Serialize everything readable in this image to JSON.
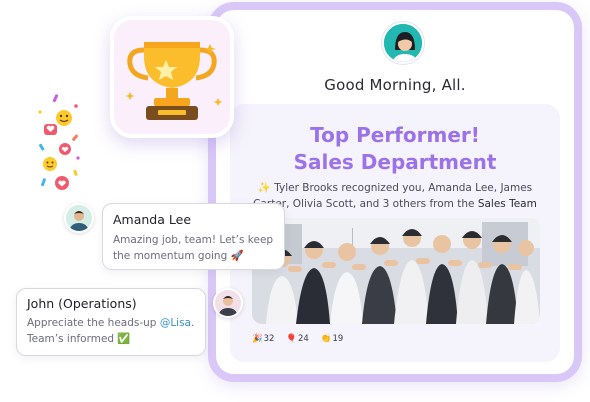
{
  "card": {
    "greeting": "Good Morning, All.",
    "title_line1": "Top Performer!",
    "title_line2": "Sales Department",
    "recognition_prefix": "✨ Tyler Brooks recognized you, Amanda Lee, James Carter, Olivia Scott, and 3 others from the ",
    "recognition_team": "Sales Team",
    "reactions": [
      {
        "emoji": "🎉",
        "count": "32"
      },
      {
        "emoji": "🎈",
        "count": "24"
      },
      {
        "emoji": "👏",
        "count": "19"
      }
    ]
  },
  "chat": {
    "amanda": {
      "name": "Amanda Lee",
      "message": "Amazing job, team! Let’s keep the momentum going 🚀"
    },
    "john": {
      "name": "John (Operations)",
      "message_before": "Appreciate the heads-up ",
      "mention": "@Lisa",
      "message_after": ". Team’s informed ✅"
    }
  },
  "colors": {
    "accent": "#9b72e8",
    "card_border": "#d9c8f7",
    "panel_bg": "#f5f3fc",
    "mention": "#3a8ec9"
  },
  "icons": [
    "trophy-icon",
    "heart-icon",
    "smiley-icon",
    "party-popper-icon",
    "balloon-icon",
    "clapping-hands-icon"
  ]
}
